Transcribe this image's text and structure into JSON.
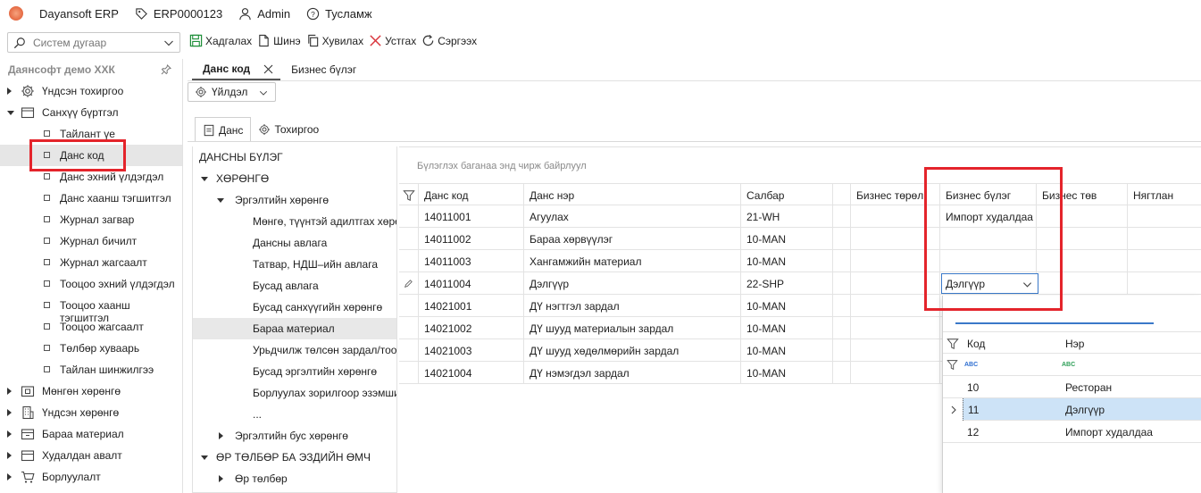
{
  "titlebar": {
    "app_name": "Dayansoft ERP",
    "record_code": "ERP0000123",
    "user": "Admin",
    "help": "Тусламж"
  },
  "toolbar": {
    "search_placeholder": "Систем дугаар",
    "actions": {
      "save": "Хадгалах",
      "new": "Шинэ",
      "copy": "Хувилах",
      "delete": "Устгах",
      "refresh": "Сэргээх"
    }
  },
  "sidebar": {
    "company": "Даянсофт демо ХХК",
    "items": [
      {
        "label": "Үндсэн тохиргоо",
        "icon": "gear-icon",
        "expanded": false
      },
      {
        "label": "Санхүү бүртгэл",
        "icon": "folder-icon",
        "expanded": true
      },
      {
        "label": "Мөнгөн хөрөнгө",
        "icon": "cash-icon",
        "expanded": false
      },
      {
        "label": "Үндсэн хөрөнгө",
        "icon": "building-icon",
        "expanded": false
      },
      {
        "label": "Бараа материал",
        "icon": "box-icon",
        "expanded": false
      },
      {
        "label": "Худалдан авалт",
        "icon": "purchase-icon",
        "expanded": false
      },
      {
        "label": "Борлуулалт",
        "icon": "cart-icon",
        "expanded": false
      }
    ],
    "finance_children": [
      "Тайлант үе",
      "Данс код",
      "Данс эхний үлдэгдэл",
      "Данс хаанш тэгшитгэл",
      "Журнал загвар",
      "Журнал бичилт",
      "Журнал жагсаалт",
      "Тооцоо эхний үлдэгдэл",
      "Тооцоо хаанш тэгшитгэл",
      "Тооцоо жагсаалт",
      "Төлбөр хуваарь",
      "Тайлан шинжилгээ"
    ],
    "selected_child": "Данс код"
  },
  "tabs": [
    {
      "label": "Данс код",
      "active": true
    },
    {
      "label": "Бизнес бүлэг",
      "active": false
    }
  ],
  "action_dropdown": "Үйлдэл",
  "sub_tabs": [
    {
      "label": "Данс",
      "active": true
    },
    {
      "label": "Тохиргоо",
      "active": false
    }
  ],
  "account_tree": [
    {
      "label": "ДАНСНЫ БҮЛЭГ",
      "level": 0,
      "arrow": "none"
    },
    {
      "label": "ХӨРӨНГӨ",
      "level": 0,
      "arrow": "down"
    },
    {
      "label": "Эргэлтийн хөрөнгө",
      "level": 1,
      "arrow": "down"
    },
    {
      "label": "Мөнгө, түүнтэй адилтгах хөрөнгө",
      "level": 2,
      "arrow": "none"
    },
    {
      "label": "Дансны авлага",
      "level": 2,
      "arrow": "none"
    },
    {
      "label": "Татвар, НДШ–ийн авлага",
      "level": 2,
      "arrow": "none"
    },
    {
      "label": "Бусад авлага",
      "level": 2,
      "arrow": "none"
    },
    {
      "label": "Бусад санхүүгийн хөрөнгө",
      "level": 2,
      "arrow": "none"
    },
    {
      "label": "Бараа материал",
      "level": 2,
      "arrow": "none",
      "selected": true
    },
    {
      "label": "Урьдчилж төлсөн зардал/тооцоо",
      "level": 2,
      "arrow": "none"
    },
    {
      "label": "Бусад эргэлтийн хөрөнгө",
      "level": 2,
      "arrow": "none"
    },
    {
      "label": "Борлуулах зорилгоор эзэмшиж буй",
      "level": 2,
      "arrow": "none"
    },
    {
      "label": "...",
      "level": 2,
      "arrow": "none"
    },
    {
      "label": "Эргэлтийн бус хөрөнгө",
      "level": 1,
      "arrow": "right"
    },
    {
      "label": "ӨР ТӨЛБӨР БА ЭЗДИЙН ӨМЧ",
      "level": 0,
      "arrow": "down"
    },
    {
      "label": "Өр төлбөр",
      "level": 1,
      "arrow": "right"
    }
  ],
  "grid": {
    "group_hint": "Бүлэглэх баганаа энд чирж байрлуул",
    "columns": [
      "Данс код",
      "Данс нэр",
      "Салбар",
      "",
      "Бизнес төрөл",
      "Бизнес бүлэг",
      "Бизнес төв",
      "Нягтлан"
    ],
    "rows": [
      {
        "code": "14011001",
        "name": "Агуулах",
        "branch": "21-WH",
        "group": "Импорт худалдаа"
      },
      {
        "code": "14011002",
        "name": "Бараа хөрвүүлэг",
        "branch": "10-MAN",
        "group": ""
      },
      {
        "code": "14011003",
        "name": "Хангамжийн материал",
        "branch": "10-MAN",
        "group": ""
      },
      {
        "code": "14011004",
        "name": "Дэлгүүр",
        "branch": "22-SHP",
        "group": "",
        "editing": true
      },
      {
        "code": "14021001",
        "name": "ДҮ нэгтгэл зардал",
        "branch": "10-MAN",
        "group": ""
      },
      {
        "code": "14021002",
        "name": "ДҮ шууд материалын зардал",
        "branch": "10-MAN",
        "group": ""
      },
      {
        "code": "14021003",
        "name": "ДҮ шууд хөдөлмөрийн зардал",
        "branch": "10-MAN",
        "group": ""
      },
      {
        "code": "14021004",
        "name": "ДҮ нэмэгдэл зардал",
        "branch": "10-MAN",
        "group": ""
      }
    ],
    "editor_value": "Дэлгүүр"
  },
  "lookup": {
    "search_value": "",
    "columns": [
      "Код",
      "Нэр"
    ],
    "filter_badge": "ABC",
    "rows": [
      {
        "code": "10",
        "name": "Ресторан"
      },
      {
        "code": "11",
        "name": "Дэлгүүр",
        "selected": true
      },
      {
        "code": "12",
        "name": "Импорт худалдаа"
      }
    ]
  },
  "colors": {
    "highlight_red": "#e4242b",
    "selection_blue": "#cde3f7",
    "editor_border": "#3a78c8",
    "save_green": "#1f8f3a",
    "delete_red": "#d9363e"
  }
}
